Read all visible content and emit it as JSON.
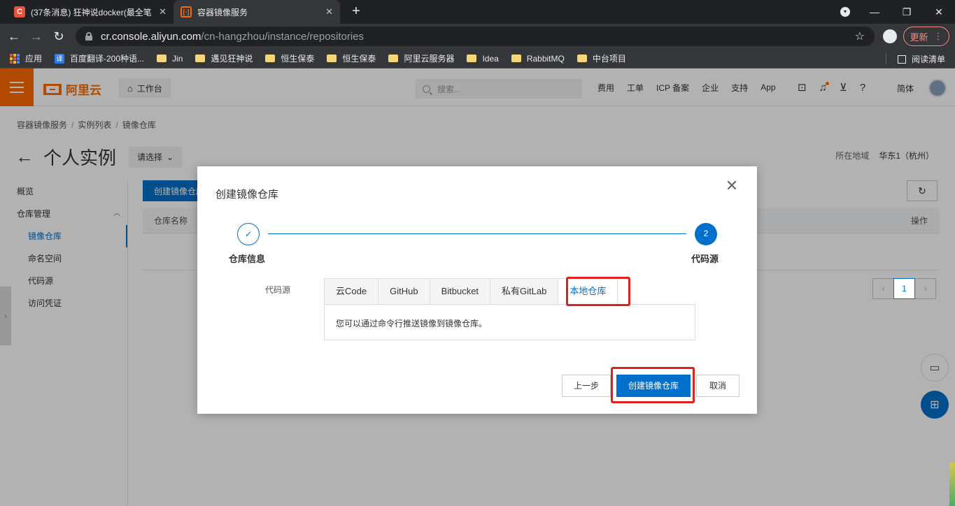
{
  "browser": {
    "tabs": [
      {
        "icon": "C",
        "title": "(37条消息) 狂神说docker(最全笔",
        "close": "✕"
      },
      {
        "icon": "[-]",
        "title": "容器镜像服务",
        "close": "✕"
      }
    ],
    "new_tab": "+",
    "window_controls": {
      "minimize": "—",
      "maximize": "❐",
      "close": "✕"
    },
    "url_host": "cr.console.aliyun.com",
    "url_path": "/cn-hangzhou/instance/repositories",
    "update_button": "更新",
    "bookmarks": [
      "应用",
      "百度翻译-200种语...",
      "Jin",
      "遇见狂神说",
      "恒生保泰",
      "恒生保泰",
      "阿里云服务器",
      "Idea",
      "RabbitMQ",
      "中台项目"
    ],
    "reading_list": "阅读清单"
  },
  "console": {
    "logo": "阿里云",
    "workbench": "工作台",
    "search_placeholder": "搜索...",
    "nav_links": [
      "费用",
      "工单",
      "ICP 备案",
      "企业",
      "支持",
      "App"
    ],
    "lang": "简体",
    "breadcrumb": [
      "容器镜像服务",
      "实例列表",
      "镜像仓库"
    ],
    "page_title": "个人实例",
    "select_label": "请选择",
    "region_label": "所在地域",
    "region_value": "华东1（杭州）",
    "sidebar": {
      "overview": "概览",
      "repo_mgmt": "仓库管理",
      "items": [
        "镜像仓库",
        "命名空间",
        "代码源",
        "访问凭证"
      ]
    },
    "create_button": "创建镜像仓库",
    "table_headers": {
      "name": "仓库名称",
      "actions": "操作"
    },
    "pager_current": "1"
  },
  "dialog": {
    "title": "创建镜像仓库",
    "steps": [
      {
        "number": "✓",
        "label": "仓库信息"
      },
      {
        "number": "2",
        "label": "代码源"
      }
    ],
    "field_label": "代码源",
    "source_tabs": [
      "云Code",
      "GitHub",
      "Bitbucket",
      "私有GitLab",
      "本地仓库"
    ],
    "active_tab": "本地仓库",
    "panel_text": "您可以通过命令行推送镜像到镜像仓库。",
    "buttons": {
      "prev": "上一步",
      "create": "创建镜像仓库",
      "cancel": "取消"
    }
  },
  "colors": {
    "accent": "#0070cc",
    "brand": "#ff6a00",
    "highlight": "#e0201a"
  }
}
